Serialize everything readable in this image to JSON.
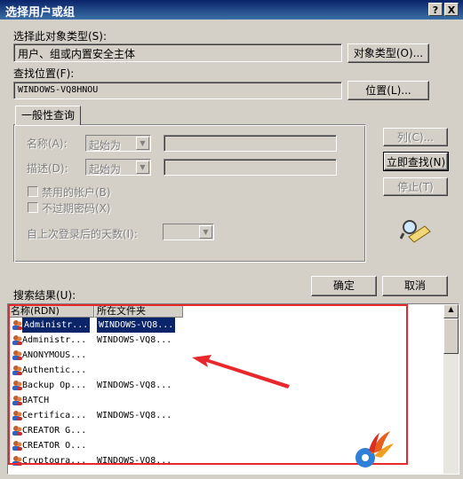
{
  "window": {
    "title": "选择用户或组",
    "help_btn": "?",
    "close_btn": "X"
  },
  "object_type": {
    "label": "选择此对象类型(S):",
    "value": "用户、组或内置安全主体",
    "button": "对象类型(O)..."
  },
  "location": {
    "label": "查找位置(F):",
    "value": "WINDOWS-VQ8HNOU",
    "button": "位置(L)..."
  },
  "query": {
    "tab": "一般性查询",
    "name_label": "名称(A):",
    "desc_label": "描述(D):",
    "name_combo": "起始为",
    "desc_combo": "起始为",
    "chk_disabled": "禁用的帐户(B)",
    "chk_noexpire": "不过期密码(X)",
    "days_label": "自上次登录后的天数(I):"
  },
  "side_buttons": {
    "columns": "列(C)...",
    "find_now": "立即查找(N)",
    "stop": "停止(T)"
  },
  "ok": "确定",
  "cancel": "取消",
  "results": {
    "label": "搜索结果(U):",
    "col_name": "名称(RDN)",
    "col_folder": "所在文件夹",
    "rows": [
      {
        "name": "Administr...",
        "folder": "WINDOWS-VQ8..."
      },
      {
        "name": "Administr...",
        "folder": "WINDOWS-VQ8..."
      },
      {
        "name": "ANONYMOUS...",
        "folder": ""
      },
      {
        "name": "Authentic...",
        "folder": ""
      },
      {
        "name": "Backup Op...",
        "folder": "WINDOWS-VQ8..."
      },
      {
        "name": "BATCH",
        "folder": ""
      },
      {
        "name": "Certifica...",
        "folder": "WINDOWS-VQ8..."
      },
      {
        "name": "CREATOR G...",
        "folder": ""
      },
      {
        "name": "CREATOR O...",
        "folder": ""
      },
      {
        "name": "Cryptogra...",
        "folder": "WINDOWS-VQ8..."
      }
    ]
  },
  "colors": {
    "title_bar": "#0a246a",
    "selection": "#0a246a",
    "annotation": "#e8282c"
  }
}
